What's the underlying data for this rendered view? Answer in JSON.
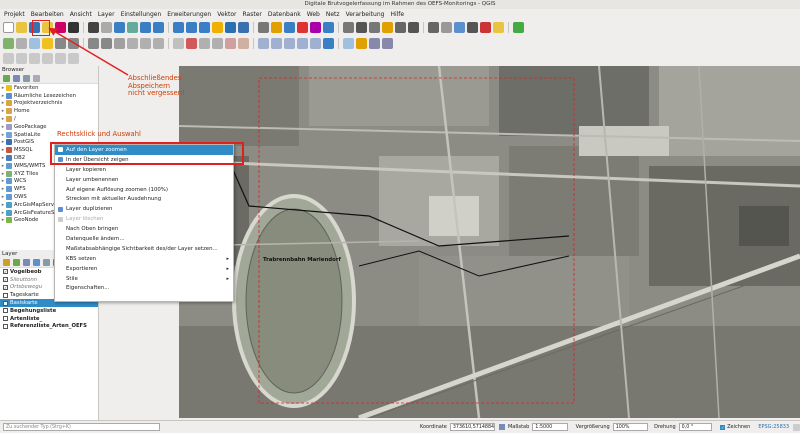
{
  "window_title": "Digitale Brutvogelerfassung im Rahmen des OEFS-Monitorings - QGIS",
  "menu": [
    "Projekt",
    "Bearbeiten",
    "Ansicht",
    "Layer",
    "Einstellungen",
    "Erweiterungen",
    "Vektor",
    "Raster",
    "Datenbank",
    "Web",
    "Netz",
    "Verarbeitung",
    "Hilfe"
  ],
  "browser": {
    "title": "Browser",
    "items": [
      {
        "label": "Favoriten",
        "icon": "star-icon",
        "color": "#e8c21b"
      },
      {
        "label": "Räumliche Lesezeichen",
        "icon": "bookmark-icon",
        "color": "#5a8fd0"
      },
      {
        "label": "Projektverzeichnis",
        "icon": "folder-icon",
        "color": "#d9a441"
      },
      {
        "label": "Home",
        "icon": "folder-icon",
        "color": "#d9a441"
      },
      {
        "label": "/",
        "icon": "folder-icon",
        "color": "#d9a441"
      },
      {
        "label": "GeoPackage",
        "icon": "geopackage-icon",
        "color": "#9c9cc9"
      },
      {
        "label": "SpatiaLite",
        "icon": "spatialite-icon",
        "color": "#6fa5d8"
      },
      {
        "label": "PostGIS",
        "icon": "postgis-icon",
        "color": "#3b6fb0"
      },
      {
        "label": "MSSQL",
        "icon": "mssql-icon",
        "color": "#c8553d"
      },
      {
        "label": "DB2",
        "icon": "db2-icon",
        "color": "#4a7bbf"
      },
      {
        "label": "WMS/WMTS",
        "icon": "wms-icon",
        "color": "#5f9bd1"
      },
      {
        "label": "XYZ Tiles",
        "icon": "xyz-icon",
        "color": "#7fb26b"
      },
      {
        "label": "WCS",
        "icon": "wcs-icon",
        "color": "#5f9bd1"
      },
      {
        "label": "WFS",
        "icon": "wfs-icon",
        "color": "#5f9bd1"
      },
      {
        "label": "OWS",
        "icon": "ows-icon",
        "color": "#5f9bd1"
      },
      {
        "label": "ArcGisMapServer",
        "icon": "arcgis-icon",
        "color": "#4aa0c8"
      },
      {
        "label": "ArcGisFeatureServer",
        "icon": "arcgis-icon",
        "color": "#4aa0c8"
      },
      {
        "label": "GeoNode",
        "icon": "geonode-icon",
        "color": "#7ab648"
      }
    ]
  },
  "layers": {
    "title": "Layer",
    "items": [
      {
        "label": "Vogelbeob",
        "checked": true,
        "bold": true,
        "italic": false
      },
      {
        "label": "Sileuttonn",
        "checked": true,
        "bold": false,
        "italic": true
      },
      {
        "label": "Ortsbewegu",
        "checked": true,
        "bold": false,
        "italic": true
      },
      {
        "label": "Tageskarte",
        "checked": false,
        "bold": false,
        "italic": false
      },
      {
        "label": "Basiskarte",
        "checked": true,
        "bold": false,
        "italic": false,
        "selected": true
      },
      {
        "label": "Begehungsliste",
        "checked": false,
        "bold": true,
        "italic": false
      },
      {
        "label": "Artenliste_",
        "checked": false,
        "bold": true,
        "italic": false
      },
      {
        "label": "Referenzliste_Arten_OEFS",
        "checked": false,
        "bold": true,
        "italic": false
      }
    ]
  },
  "context_menu": [
    {
      "label": "Auf den Layer zoomen",
      "highlight": true,
      "icon": "zoom-layer-icon"
    },
    {
      "label": "In der Übersicht zeigen",
      "icon": "overview-icon"
    },
    {
      "label": "Layer kopieren"
    },
    {
      "label": "Layer umbenennen"
    },
    {
      "label": "Auf eigene Auflösung zoomen (100%)"
    },
    {
      "label": "Strecken mit aktueller Ausdehnung"
    },
    {
      "label": "Layer duplizieren",
      "icon": "duplicate-icon"
    },
    {
      "label": "Layer löschen",
      "disabled": true,
      "icon": "remove-icon"
    },
    {
      "label": "Nach Oben bringen"
    },
    {
      "label": "Datenquelle ändern..."
    },
    {
      "label": "Maßstabsabhängige Sichtbarkeit des/der Layer setzen..."
    },
    {
      "label": "KBS setzen",
      "submenu": true
    },
    {
      "label": "Exportieren",
      "submenu": true
    },
    {
      "label": "Stile",
      "submenu": true
    },
    {
      "label": "Eigenschaften..."
    }
  ],
  "annotations": {
    "save_note": "Abschließendes Abspeichern nicht vergessen!",
    "right_click_note": "Rechtsklick und Auswahl"
  },
  "map": {
    "label": "Trabrennbahn Mariendorf"
  },
  "statusbar": {
    "search_placeholder": "Zu suchender Typ (Strg+K)",
    "coord_label": "Koordinate",
    "coord_value": "373610,5714884",
    "scale_label": "Maßstab",
    "scale_value": "1:5000",
    "magnifier_label": "Vergrößerung",
    "magnifier_value": "100%",
    "rotation_label": "Drehung",
    "rotation_value": "0,0 °",
    "render_label": "Zeichnen",
    "crs": "EPSG:25833"
  },
  "colors": {
    "highlight": "#308cc6",
    "annotation": "#d23a00",
    "annotation_box": "#e02020"
  }
}
